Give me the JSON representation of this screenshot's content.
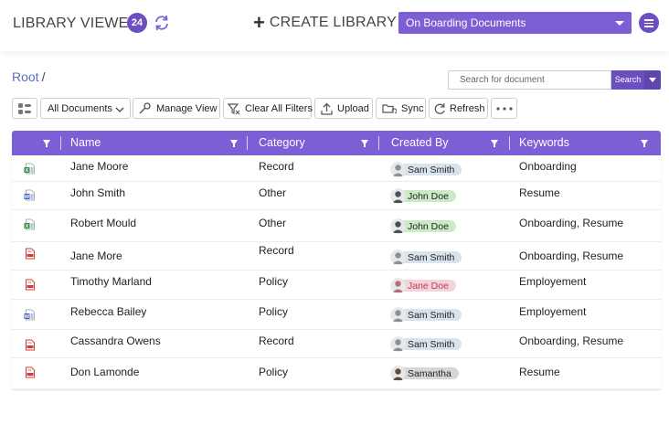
{
  "header": {
    "title": "LIBRARY VIEWER",
    "count": "24",
    "create_label": "CREATE LIBRARY",
    "library_selected": "On Boarding Documents"
  },
  "breadcrumb": {
    "root": "Root",
    "separator": "/"
  },
  "search": {
    "placeholder": "Search for document",
    "button_label": "Search"
  },
  "toolbar": {
    "view_select": "All Documents",
    "manage_view": "Manage View",
    "clear_filters": "Clear All Filters",
    "upload": "Upload",
    "sync": "Sync",
    "refresh": "Refresh"
  },
  "table": {
    "columns": [
      "Name",
      "Category",
      "Created By",
      "Keywords"
    ],
    "rows": [
      {
        "icon": "excel-file-icon",
        "name": "Jane Moore",
        "category": "Record",
        "created_by": "Sam Smith",
        "keywords": "Onboarding"
      },
      {
        "icon": "word-file-icon",
        "name": "John Smith",
        "category": "Other",
        "created_by": "John Doe",
        "keywords": "Resume"
      },
      {
        "icon": "excel-file-icon",
        "name": "Robert Mould",
        "category": "Other",
        "created_by": "John Doe",
        "keywords": "Onboarding, Resume"
      },
      {
        "icon": "pdf-file-icon",
        "name": "Jane More",
        "category": "Record",
        "created_by": "Sam Smith",
        "keywords": "Onboarding, Resume"
      },
      {
        "icon": "pdf-file-icon",
        "name": "Timothy Marland",
        "category": "Policy",
        "created_by": "Jane Doe",
        "keywords": "Employement"
      },
      {
        "icon": "word-file-icon",
        "name": "Rebecca Bailey",
        "category": "Policy",
        "created_by": "Sam Smith",
        "keywords": "Employement"
      },
      {
        "icon": "pdf-file-icon",
        "name": "Cassandra Owens",
        "category": "Record",
        "created_by": "Sam Smith",
        "keywords": "Onboarding, Resume"
      },
      {
        "icon": "pdf-file-icon",
        "name": "Don Lamonde",
        "category": "Policy",
        "created_by": "Samantha",
        "keywords": "Resume"
      }
    ]
  },
  "colors": {
    "accent": "#7c5fd4",
    "accent_dark": "#6b4fc1",
    "chip_sam_smith": "#d9e3ee",
    "chip_john_doe": "#c9ecc4",
    "chip_jane_doe": "#f3d3dc",
    "chip_samantha": "#d6d6d6",
    "text_jane_doe": "#c0394f"
  }
}
